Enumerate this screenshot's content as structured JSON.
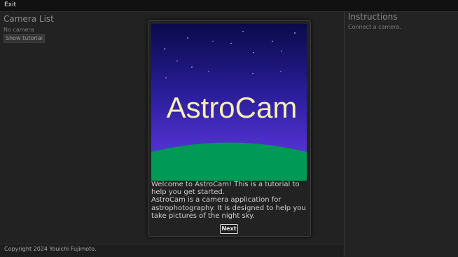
{
  "menu": {
    "exit_label": "Exit"
  },
  "camera_list": {
    "title": "Camera List",
    "status": "No camera",
    "tutorial_button": "Show tutorial"
  },
  "instructions": {
    "title": "Instructions",
    "status": "Connect a camera."
  },
  "dialog": {
    "hero_title": "AstroCam",
    "line1": "Welcome to AstroCam! This is a tutorial to help you get started.",
    "line2": "AstroCam is a camera application for astrophotography. It is designed to help you take pictures of the night sky.",
    "next_button": "Next"
  },
  "footer": {
    "copyright": "Copyright 2024 Youichi Fujimoto."
  },
  "colors": {
    "sky_top": "#0a0a4a",
    "sky_bottom": "#6a3cf0",
    "ground": "#009955",
    "hero_title": "#f6f0b0"
  }
}
